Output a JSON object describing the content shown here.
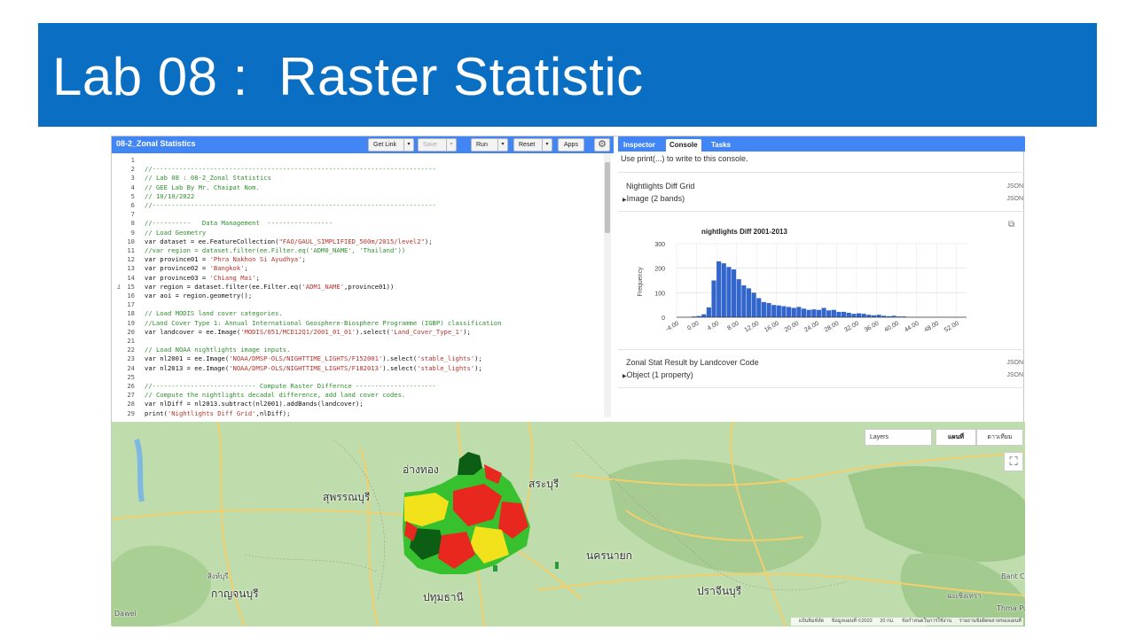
{
  "banner": {
    "title": "Lab 08 :  Raster Statistic"
  },
  "editor": {
    "script_name": "08-2_Zonal Statistics",
    "toolbar": {
      "get_link": "Get Link",
      "save": "Save",
      "run": "Run",
      "reset": "Reset",
      "apps": "Apps"
    },
    "lines": [
      {
        "n": "1",
        "t": "",
        "s": "code"
      },
      {
        "n": "2",
        "t": "//--------------------------------------------------------------------------",
        "s": "com"
      },
      {
        "n": "3",
        "t": "// Lab 08 : 08-2_Zonal Statistics",
        "s": "com"
      },
      {
        "n": "4",
        "t": "// GEE Lab By Mr. Chaipat Nom.",
        "s": "com"
      },
      {
        "n": "5",
        "t": "// 10/10/2022",
        "s": "com"
      },
      {
        "n": "6",
        "t": "//--------------------------------------------------------------------------",
        "s": "com"
      },
      {
        "n": "7",
        "t": "",
        "s": "code"
      },
      {
        "n": "8",
        "t": "//----------   Data Management  -----------------",
        "s": "com"
      },
      {
        "n": "9",
        "t": "// Load Geometry",
        "s": "com"
      },
      {
        "n": "10",
        "t": "var dataset = ee.FeatureCollection(\"FAO/GAUL_SIMPLIFIED_500m/2015/level2\");",
        "s": "code"
      },
      {
        "n": "11",
        "t": "//var region = dataset.filter(ee.Filter.eq('ADM0_NAME', 'Thailand'))",
        "s": "com"
      },
      {
        "n": "12",
        "t": "var province01 = 'Phra Nakhon Si Ayudhya';",
        "s": "code"
      },
      {
        "n": "13",
        "t": "var province02 = 'Bangkok';",
        "s": "code"
      },
      {
        "n": "14",
        "t": "var province03 = 'Chiang Mai';",
        "s": "code"
      },
      {
        "n": "15",
        "t": "var region = dataset.filter(ee.Filter.eq('ADM1_NAME',province01))",
        "s": "code"
      },
      {
        "n": "16",
        "t": "var aoi = region.geometry();",
        "s": "code"
      },
      {
        "n": "17",
        "t": "",
        "s": "code"
      },
      {
        "n": "18",
        "t": "// Load MODIS land cover categories.",
        "s": "com"
      },
      {
        "n": "19",
        "t": "//Land Cover Type 1: Annual International Geosphere-Biosphere Programme (IGBP) classification",
        "s": "com"
      },
      {
        "n": "20",
        "t": "var landcover = ee.Image('MODIS/051/MCD12Q1/2001_01_01').select('Land_Cover_Type_1');",
        "s": "code"
      },
      {
        "n": "21",
        "t": "",
        "s": "code"
      },
      {
        "n": "22",
        "t": "// Load NOAA nightlights image inputs.",
        "s": "com"
      },
      {
        "n": "23",
        "t": "var nl2001 = ee.Image('NOAA/DMSP-OLS/NIGHTTIME_LIGHTS/F152001').select('stable_lights');",
        "s": "code"
      },
      {
        "n": "24",
        "t": "var nl2013 = ee.Image('NOAA/DMSP-OLS/NIGHTTIME_LIGHTS/F182013').select('stable_lights');",
        "s": "code"
      },
      {
        "n": "25",
        "t": "",
        "s": "code"
      },
      {
        "n": "26",
        "t": "//--------------------------- Compute Raster Differnce ---------------------",
        "s": "com"
      },
      {
        "n": "27",
        "t": "// Compute the nightlights decadal difference, add land cover codes.",
        "s": "com"
      },
      {
        "n": "28",
        "t": "var nlDiff = nl2013.subtract(nl2001).addBands(landcover);",
        "s": "code"
      },
      {
        "n": "29",
        "t": "print('Nightlights Diff Grid',nlDiff);",
        "s": "code"
      }
    ]
  },
  "panel": {
    "tabs": [
      "Inspector",
      "Console",
      "Tasks"
    ],
    "active_tab": "Console",
    "hint": "Use print(...) to write to this console.",
    "entries": [
      {
        "title": "Nightlights Diff Grid",
        "json": "JSON",
        "sub": "Image (2 bands)",
        "sub_json": "JSON"
      },
      {
        "title": "Zonal Stat Result by Landcover Code",
        "json": "JSON",
        "sub": "Object (1 property)",
        "sub_json": "JSON"
      }
    ]
  },
  "chart_data": {
    "type": "bar",
    "title": "nightlights Diff 2001-2013",
    "ylabel": "Frequency",
    "xlabel": "",
    "ylim": [
      0,
      300
    ],
    "yticks": [
      0,
      100,
      200,
      300
    ],
    "xticks": [
      "-4.00",
      "0.00",
      "4.00",
      "8.00",
      "12.00",
      "16.00",
      "20.00",
      "24.00",
      "28.00",
      "32.00",
      "36.00",
      "40.00",
      "44.00",
      "48.00",
      "52.00"
    ],
    "xlim": [
      -4,
      54
    ],
    "bin_width": 1,
    "bins_start": [
      -1,
      0,
      1,
      2,
      3,
      4,
      5,
      6,
      7,
      8,
      9,
      10,
      11,
      12,
      13,
      14,
      15,
      16,
      17,
      18,
      19,
      20,
      21,
      22,
      23,
      24,
      25,
      26,
      27,
      28,
      29,
      30,
      31,
      32,
      33,
      34,
      35,
      36,
      37,
      38,
      39,
      40,
      41
    ],
    "values": [
      3,
      5,
      12,
      40,
      150,
      228,
      220,
      205,
      195,
      155,
      130,
      118,
      100,
      78,
      62,
      58,
      50,
      48,
      45,
      42,
      38,
      42,
      35,
      30,
      32,
      30,
      38,
      28,
      30,
      22,
      22,
      18,
      14,
      16,
      14,
      10,
      8,
      10,
      6,
      4,
      6,
      3,
      3
    ]
  },
  "map": {
    "layers_label": "Layers",
    "map_types": [
      "แผนที่",
      "ดาวเทียม"
    ],
    "attribution": [
      "แป้นพิมพ์ลัด",
      "ข้อมูลแผนที่ ©2022",
      "20 กม.",
      "ข้อกำหนดในการใช้งาน",
      "รายงานข้อผิดพลาดของแผนที่"
    ],
    "places": [
      "อ่างทอง",
      "สุพรรณบุรี",
      "สระบุรี",
      "นครนายก",
      "ปราจีนบุรี",
      "ปทุมธานี",
      "กาญจนบุรี",
      "สิงห์บุรี",
      "ฉะเชิงเทรา",
      "Bant Chho",
      "Thma Puo",
      "Dawei"
    ],
    "colors": {
      "bg": "#b9d9a5",
      "road": "#f6d27a",
      "park": "#8fbf7e",
      "red": "#e8281f",
      "yellow": "#f2e21c",
      "green": "#38c12f",
      "dark": "#0b5e14"
    }
  }
}
